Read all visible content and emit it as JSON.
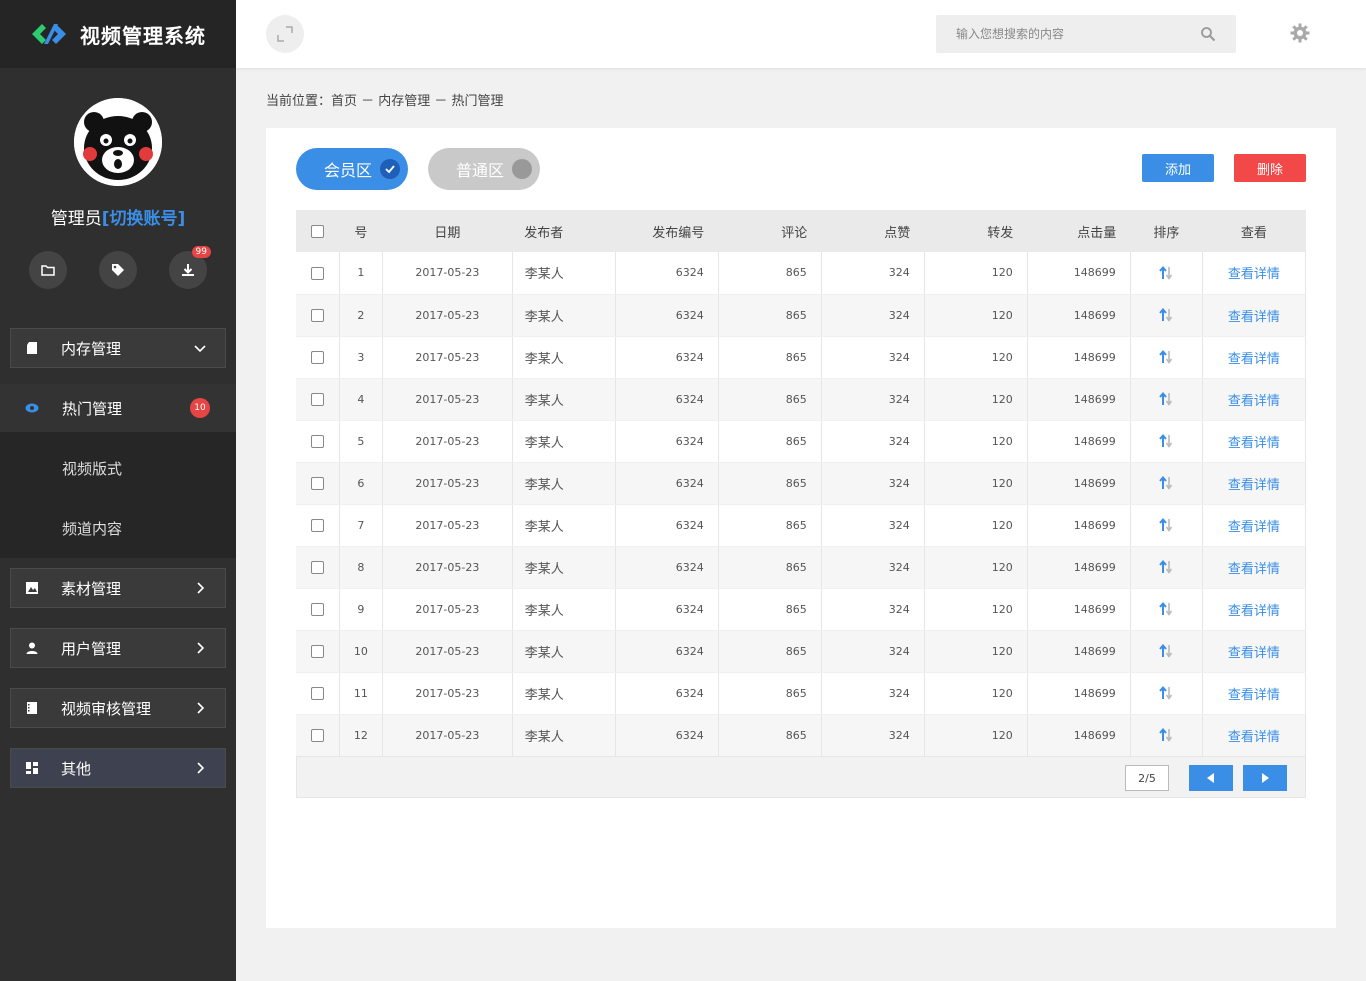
{
  "brand": {
    "title": "视频管理系统"
  },
  "user": {
    "role": "管理员",
    "switch_label": "[切换账号]",
    "download_badge": "99"
  },
  "menu": {
    "memory": "内存管理",
    "sub": [
      {
        "label": "热门管理",
        "count": "10"
      },
      {
        "label": "视频版式"
      },
      {
        "label": "频道内容"
      }
    ],
    "material": "素材管理",
    "user": "用户管理",
    "review": "视频审核管理",
    "other": "其他"
  },
  "header": {
    "search_placeholder": "输入您想搜索的内容"
  },
  "breadcrumb": "当前位置：首页 － 内存管理 － 热门管理",
  "toggles": {
    "member": "会员区",
    "normal": "普通区"
  },
  "actions": {
    "add": "添加",
    "delete": "删除"
  },
  "table": {
    "headers": [
      "号",
      "日期",
      "发布者",
      "发布编号",
      "评论",
      "点赞",
      "转发",
      "点击量",
      "排序",
      "查看"
    ],
    "rows": [
      [
        "1",
        "2017-05-23",
        "李某人",
        "6324",
        "865",
        "324",
        "120",
        "148699",
        "查看详情"
      ],
      [
        "2",
        "2017-05-23",
        "李某人",
        "6324",
        "865",
        "324",
        "120",
        "148699",
        "查看详情"
      ],
      [
        "3",
        "2017-05-23",
        "李某人",
        "6324",
        "865",
        "324",
        "120",
        "148699",
        "查看详情"
      ],
      [
        "4",
        "2017-05-23",
        "李某人",
        "6324",
        "865",
        "324",
        "120",
        "148699",
        "查看详情"
      ],
      [
        "5",
        "2017-05-23",
        "李某人",
        "6324",
        "865",
        "324",
        "120",
        "148699",
        "查看详情"
      ],
      [
        "6",
        "2017-05-23",
        "李某人",
        "6324",
        "865",
        "324",
        "120",
        "148699",
        "查看详情"
      ],
      [
        "7",
        "2017-05-23",
        "李某人",
        "6324",
        "865",
        "324",
        "120",
        "148699",
        "查看详情"
      ],
      [
        "8",
        "2017-05-23",
        "李某人",
        "6324",
        "865",
        "324",
        "120",
        "148699",
        "查看详情"
      ],
      [
        "9",
        "2017-05-23",
        "李某人",
        "6324",
        "865",
        "324",
        "120",
        "148699",
        "查看详情"
      ],
      [
        "10",
        "2017-05-23",
        "李某人",
        "6324",
        "865",
        "324",
        "120",
        "148699",
        "查看详情"
      ],
      [
        "11",
        "2017-05-23",
        "李某人",
        "6324",
        "865",
        "324",
        "120",
        "148699",
        "查看详情"
      ],
      [
        "12",
        "2017-05-23",
        "李某人",
        "6324",
        "865",
        "324",
        "120",
        "148699",
        "查看详情"
      ]
    ]
  },
  "pager": {
    "page": "2/5"
  },
  "colors": {
    "accent": "#3a8ee6",
    "danger": "#f24848",
    "sidebar": "#2f2f2f"
  }
}
